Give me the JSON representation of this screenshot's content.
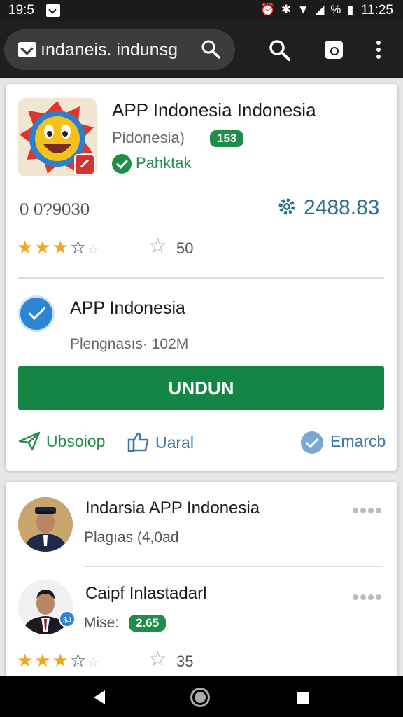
{
  "status_bar": {
    "time_left": "19:5",
    "indicators": "⏰ ✱ ▼ ◢ % ▮",
    "time_right": "11:25"
  },
  "app_bar": {
    "search_text": "ındaneis. indunsg"
  },
  "app_card": {
    "title": "APP Indonesia Indonesia",
    "developer": "Pidonesia)",
    "developer_badge": "153",
    "verified_label": "Pahktak",
    "code": "0 0?9030",
    "gear_value": "2488.83",
    "rating_count": "50"
  },
  "detail": {
    "title": "APP Indonesia",
    "size_text": "Plengnasıs· 102M",
    "install_label": "UNDUN",
    "actions": {
      "share": "Ubsoiop",
      "like": "Uaral",
      "more": "Emarcb"
    }
  },
  "reviews": [
    {
      "name": "Indarsia APP Indonesia",
      "subtitle": "Plagıas (4,0ad"
    },
    {
      "name": "Caipf Inlastadarl",
      "subtitle": "Mise:",
      "badge": "2.65",
      "rating_count": "35",
      "avatar_badge": "$J"
    }
  ],
  "colors": {
    "accent_green": "#138545",
    "accent_blue": "#2a6f96",
    "star": "#f0a823"
  }
}
